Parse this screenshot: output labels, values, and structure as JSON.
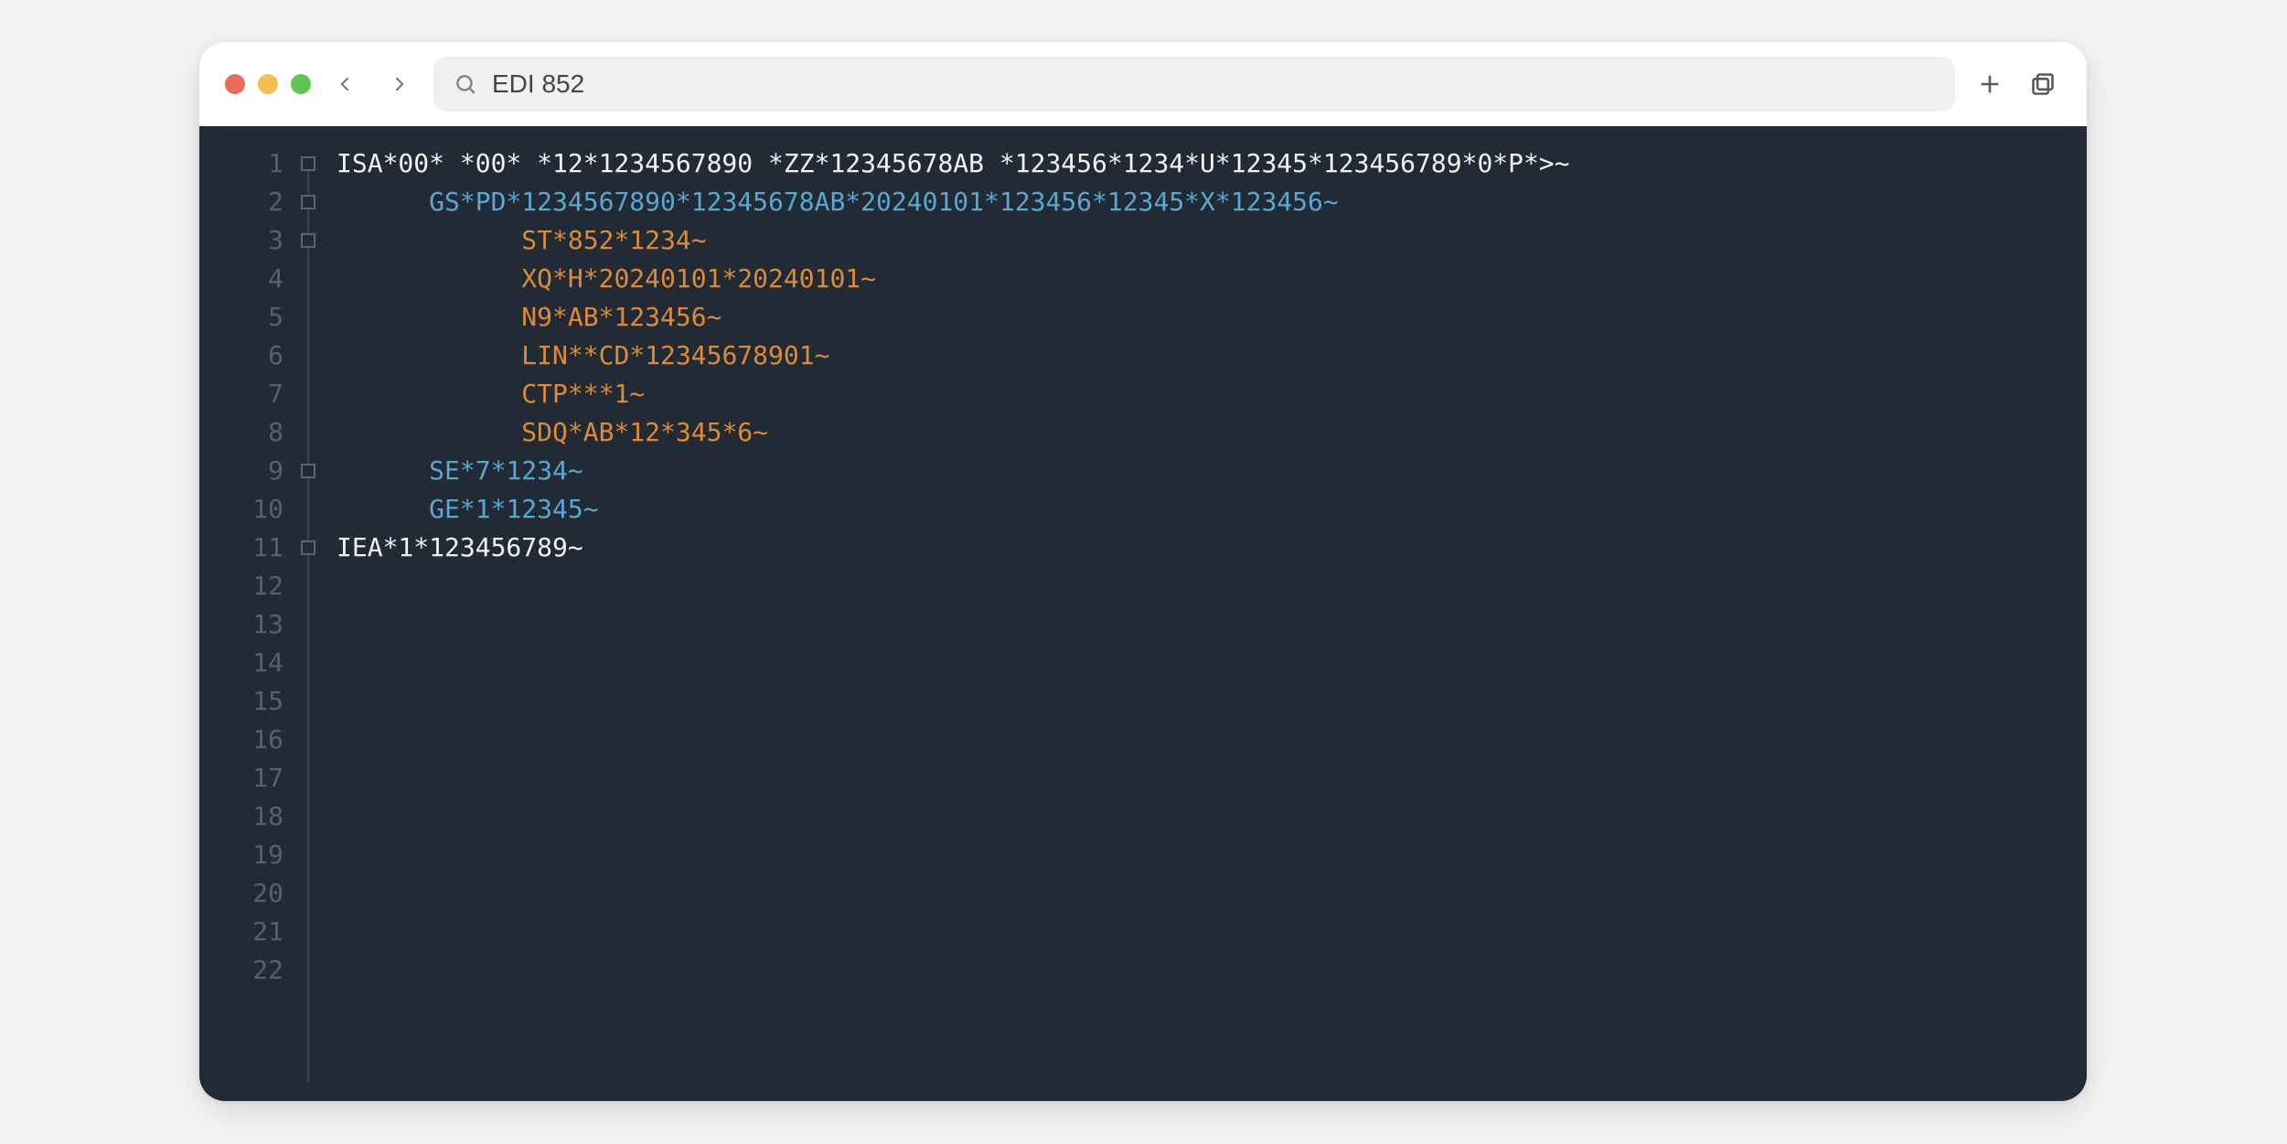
{
  "search": {
    "value": "EDI 852"
  },
  "colors": {
    "editor_bg": "#222a35",
    "line_number": "#58606b",
    "token_white": "#f2f2f2",
    "token_blue": "#5aa7d1",
    "token_orange": "#db8b3a"
  },
  "total_line_numbers": 22,
  "lines": [
    {
      "n": 1,
      "fold": true,
      "indent": 0,
      "color": "white",
      "text": "ISA*00* *00* *12*1234567890 *ZZ*12345678AB *123456*1234*U*12345*123456789*0*P*>~"
    },
    {
      "n": 2,
      "fold": true,
      "indent": 1,
      "color": "blue",
      "text": "GS*PD*1234567890*12345678AB*20240101*123456*12345*X*123456~"
    },
    {
      "n": 3,
      "fold": true,
      "indent": 2,
      "color": "orange",
      "text": "ST*852*1234~"
    },
    {
      "n": 4,
      "fold": false,
      "indent": 2,
      "color": "orange",
      "text": "XQ*H*20240101*20240101~"
    },
    {
      "n": 5,
      "fold": false,
      "indent": 2,
      "color": "orange",
      "text": "N9*AB*123456~"
    },
    {
      "n": 6,
      "fold": false,
      "indent": 2,
      "color": "orange",
      "text": "LIN**CD*12345678901~"
    },
    {
      "n": 7,
      "fold": false,
      "indent": 2,
      "color": "orange",
      "text": "CTP***1~"
    },
    {
      "n": 8,
      "fold": false,
      "indent": 2,
      "color": "orange",
      "text": "SDQ*AB*12*345*6~"
    },
    {
      "n": 9,
      "fold": true,
      "indent": 1,
      "color": "blue",
      "text": "SE*7*1234~"
    },
    {
      "n": 10,
      "fold": false,
      "indent": 1,
      "color": "blue",
      "text": "GE*1*12345~"
    },
    {
      "n": 11,
      "fold": true,
      "indent": 0,
      "color": "white",
      "text": "IEA*1*123456789~"
    }
  ]
}
